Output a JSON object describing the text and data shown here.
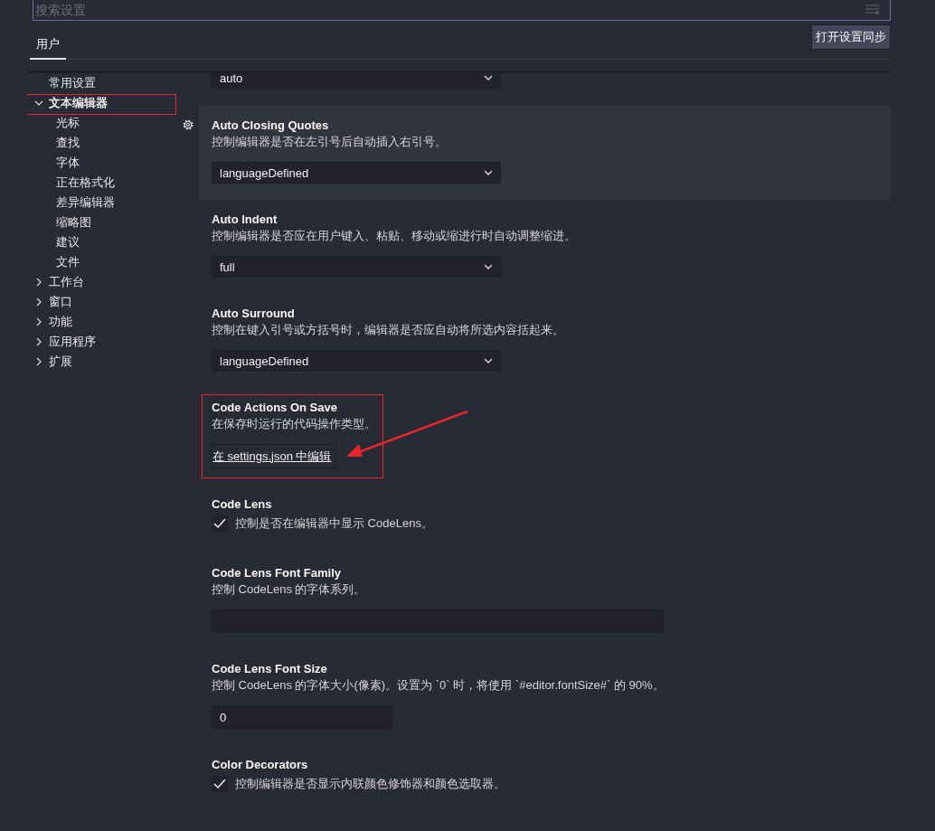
{
  "search": {
    "placeholder": "搜索设置"
  },
  "tabs": [
    {
      "label": "用户",
      "selected": true
    }
  ],
  "sync_button": "打开设置同步",
  "sidebar": {
    "items": [
      {
        "label": "常用设置"
      },
      {
        "label": "文本编辑器",
        "expanded": true,
        "highlighted": true,
        "children": [
          {
            "label": "光标"
          },
          {
            "label": "查找"
          },
          {
            "label": "字体"
          },
          {
            "label": "正在格式化"
          },
          {
            "label": "差异编辑器"
          },
          {
            "label": "缩略图"
          },
          {
            "label": "建议"
          },
          {
            "label": "文件"
          }
        ]
      },
      {
        "label": "工作台",
        "expanded": false
      },
      {
        "label": "窗口",
        "expanded": false
      },
      {
        "label": "功能",
        "expanded": false
      },
      {
        "label": "应用程序",
        "expanded": false
      },
      {
        "label": "扩展",
        "expanded": false
      }
    ]
  },
  "settings": [
    {
      "kind": "select",
      "value": "auto"
    },
    {
      "kind": "select",
      "title": "Auto Closing Quotes",
      "description": "控制编辑器是否在左引号后自动插入右引号。",
      "value": "languageDefined",
      "focused": true
    },
    {
      "kind": "select",
      "title": "Auto Indent",
      "description": "控制编辑器是否应在用户键入、粘贴、移动或缩进行时自动调整缩进。",
      "value": "full"
    },
    {
      "kind": "select",
      "title": "Auto Surround",
      "description": "控制在键入引号或方括号时，编辑器是否应自动将所选内容括起来。",
      "value": "languageDefined"
    },
    {
      "kind": "link",
      "title": "Code Actions On Save",
      "description": "在保存时运行的代码操作类型。",
      "link": "在 settings.json 中编辑",
      "highlighted": true,
      "arrow": true
    },
    {
      "kind": "checkbox",
      "title": "Code Lens",
      "description": "控制是否在编辑器中显示 CodeLens。",
      "checked": true
    },
    {
      "kind": "text",
      "title": "Code Lens Font Family",
      "description": "控制 CodeLens 的字体系列。"
    },
    {
      "kind": "number",
      "title": "Code Lens Font Size",
      "description": "控制 CodeLens 的字体大小(像素)。设置为 `0` 时，将使用 `#editor.fontSize#` 的 90%。",
      "value": "0"
    },
    {
      "kind": "checkbox",
      "title": "Color Decorators",
      "description": "控制编辑器是否显示内联颜色修饰器和颜色选取器。",
      "checked": true
    }
  ]
}
